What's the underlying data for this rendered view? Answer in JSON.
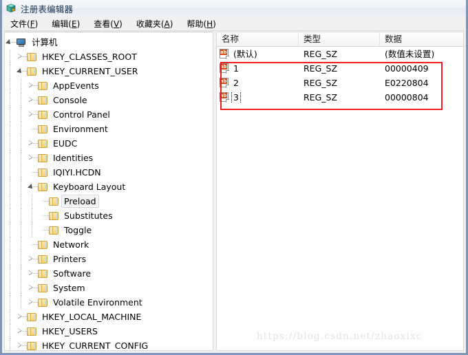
{
  "window": {
    "title": "注册表编辑器",
    "icon": "registry-editor-icon"
  },
  "menubar": {
    "items": [
      {
        "label": "文件(F)",
        "text": "文件(",
        "accel": "F",
        "tail": ")"
      },
      {
        "label": "编辑(E)",
        "text": "编辑(",
        "accel": "E",
        "tail": ")"
      },
      {
        "label": "查看(V)",
        "text": "查看(",
        "accel": "V",
        "tail": ")"
      },
      {
        "label": "收藏夹(A)",
        "text": "收藏夹(",
        "accel": "A",
        "tail": ")"
      },
      {
        "label": "帮助(H)",
        "text": "帮助(",
        "accel": "H",
        "tail": ")"
      }
    ]
  },
  "tree": {
    "nodes": [
      {
        "label": "计算机",
        "depth": 0,
        "state": "expanded",
        "icon": "computer-icon",
        "selected": false
      },
      {
        "label": "HKEY_CLASSES_ROOT",
        "depth": 1,
        "state": "collapsed",
        "icon": "folder-icon",
        "selected": false
      },
      {
        "label": "HKEY_CURRENT_USER",
        "depth": 1,
        "state": "expanded",
        "icon": "folder-icon",
        "selected": false
      },
      {
        "label": "AppEvents",
        "depth": 2,
        "state": "collapsed",
        "icon": "folder-icon",
        "selected": false
      },
      {
        "label": "Console",
        "depth": 2,
        "state": "collapsed",
        "icon": "folder-icon",
        "selected": false
      },
      {
        "label": "Control Panel",
        "depth": 2,
        "state": "collapsed",
        "icon": "folder-icon",
        "selected": false
      },
      {
        "label": "Environment",
        "depth": 2,
        "state": "leaf",
        "icon": "folder-icon",
        "selected": false
      },
      {
        "label": "EUDC",
        "depth": 2,
        "state": "collapsed",
        "icon": "folder-icon",
        "selected": false
      },
      {
        "label": "Identities",
        "depth": 2,
        "state": "collapsed",
        "icon": "folder-icon",
        "selected": false
      },
      {
        "label": "IQIYI.HCDN",
        "depth": 2,
        "state": "leaf",
        "icon": "folder-icon",
        "selected": false
      },
      {
        "label": "Keyboard Layout",
        "depth": 2,
        "state": "expanded",
        "icon": "folder-icon",
        "selected": false
      },
      {
        "label": "Preload",
        "depth": 3,
        "state": "leaf",
        "icon": "folder-icon",
        "selected": true
      },
      {
        "label": "Substitutes",
        "depth": 3,
        "state": "leaf",
        "icon": "folder-icon",
        "selected": false
      },
      {
        "label": "Toggle",
        "depth": 3,
        "state": "leaf",
        "icon": "folder-icon",
        "selected": false
      },
      {
        "label": "Network",
        "depth": 2,
        "state": "leaf",
        "icon": "folder-icon",
        "selected": false
      },
      {
        "label": "Printers",
        "depth": 2,
        "state": "collapsed",
        "icon": "folder-icon",
        "selected": false
      },
      {
        "label": "Software",
        "depth": 2,
        "state": "collapsed",
        "icon": "folder-icon",
        "selected": false
      },
      {
        "label": "System",
        "depth": 2,
        "state": "collapsed",
        "icon": "folder-icon",
        "selected": false
      },
      {
        "label": "Volatile Environment",
        "depth": 2,
        "state": "collapsed",
        "icon": "folder-icon",
        "selected": false
      },
      {
        "label": "HKEY_LOCAL_MACHINE",
        "depth": 1,
        "state": "collapsed",
        "icon": "folder-icon",
        "selected": false
      },
      {
        "label": "HKEY_USERS",
        "depth": 1,
        "state": "collapsed",
        "icon": "folder-icon",
        "selected": false
      },
      {
        "label": "HKEY_CURRENT_CONFIG",
        "depth": 1,
        "state": "collapsed",
        "icon": "folder-icon",
        "selected": false
      }
    ]
  },
  "listview": {
    "columns": [
      {
        "label": "名称"
      },
      {
        "label": "类型"
      },
      {
        "label": "数据"
      }
    ],
    "rows": [
      {
        "name": "(默认)",
        "type": "REG_SZ",
        "data": "(数值未设置)",
        "icon": "string-value-icon",
        "focused": false
      },
      {
        "name": "1",
        "type": "REG_SZ",
        "data": "00000409",
        "icon": "string-value-icon",
        "focused": false
      },
      {
        "name": "2",
        "type": "REG_SZ",
        "data": "E0220804",
        "icon": "string-value-icon",
        "focused": false
      },
      {
        "name": "3",
        "type": "REG_SZ",
        "data": "00000804",
        "icon": "string-value-icon",
        "focused": true
      }
    ]
  },
  "annotation": {
    "color": "#ee1c1c",
    "shape": "rectangle"
  },
  "watermark": {
    "text": "https://blog.csdn.net/zhaoxixc"
  }
}
